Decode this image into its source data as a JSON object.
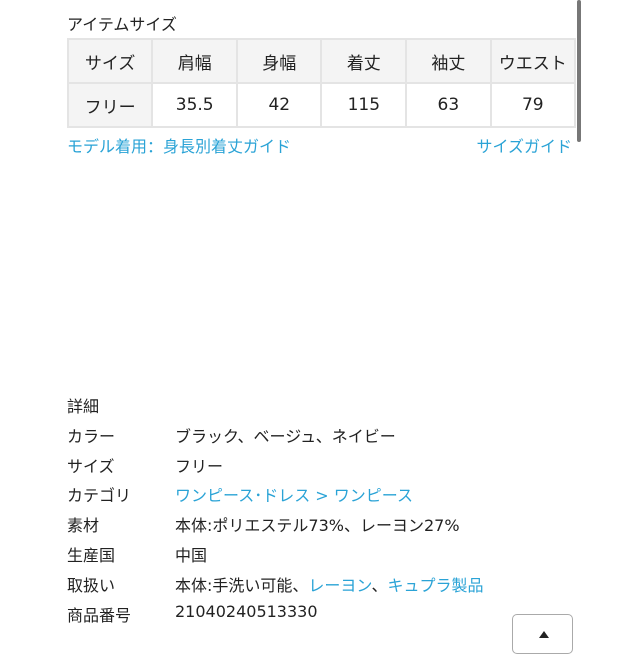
{
  "size_section": {
    "title": "アイテムサイズ",
    "headers": [
      "サイズ",
      "肩幅",
      "身幅",
      "着丈",
      "袖丈",
      "ウエスト"
    ],
    "rows": [
      [
        "フリー",
        "35.5",
        "42",
        "115",
        "63",
        "79"
      ]
    ],
    "model_link": "モデル着用：身長別着丈ガイド",
    "size_guide_link": "サイズガイド"
  },
  "details": {
    "title": "詳細",
    "color_label": "カラー",
    "color_value": "ブラック、ベージュ、ネイビー",
    "size_label": "サイズ",
    "size_value": "フリー",
    "category_label": "カテゴリ",
    "category_link1": "ワンピース･ドレス",
    "category_sep": " > ",
    "category_link2": "ワンピース",
    "material_label": "素材",
    "material_value": "本体:ポリエステル73%、レーヨン27%",
    "origin_label": "生産国",
    "origin_value": "中国",
    "care_label": "取扱い",
    "care_value": "本体:手洗い可能、",
    "care_link1": "レーヨン",
    "care_sep": "、",
    "care_link2": "キュプラ製品",
    "item_no_label": "商品番号",
    "item_no_value": "21040240513330"
  },
  "colors": {
    "link": "#2aa3d6"
  },
  "icons": {
    "back_to_top": "caret-up-icon"
  }
}
